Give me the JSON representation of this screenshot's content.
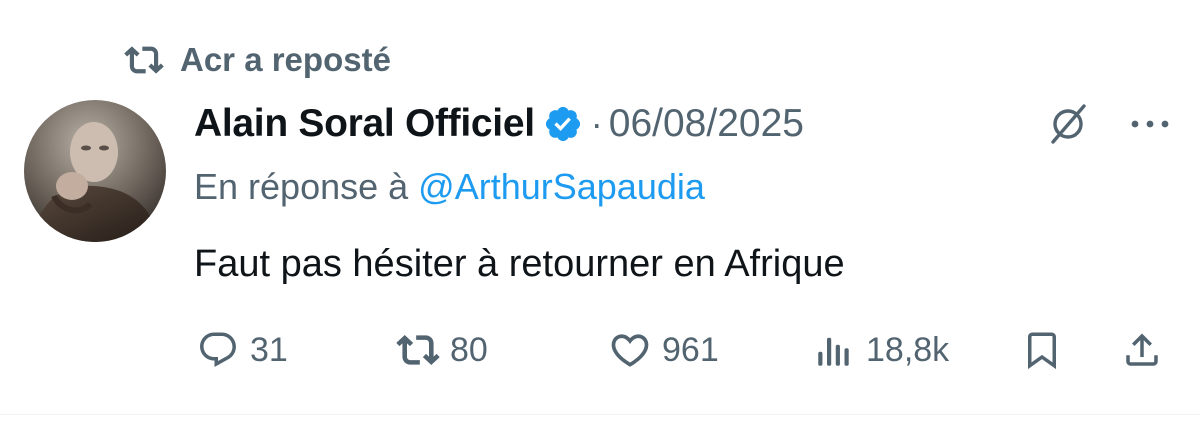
{
  "repost_banner": {
    "icon": "repost-icon",
    "text": "Acr a reposté"
  },
  "tweet": {
    "author": {
      "display_name": "Alain Soral Officiel",
      "verified": true,
      "avatar": "avatar-photo"
    },
    "separator": "·",
    "date": "06/08/2025",
    "reply_prefix": "En réponse à",
    "reply_handle": "@ArthurSapaudia",
    "text": "Faut pas hésiter à retourner en Afrique"
  },
  "actions": {
    "replies": "31",
    "reposts": "80",
    "likes": "961",
    "views": "18,8k"
  },
  "colors": {
    "secondary_text": "#536471",
    "link": "#1d9bf0",
    "primary_text": "#0f1419",
    "verified_badge": "#1d9bf0"
  }
}
